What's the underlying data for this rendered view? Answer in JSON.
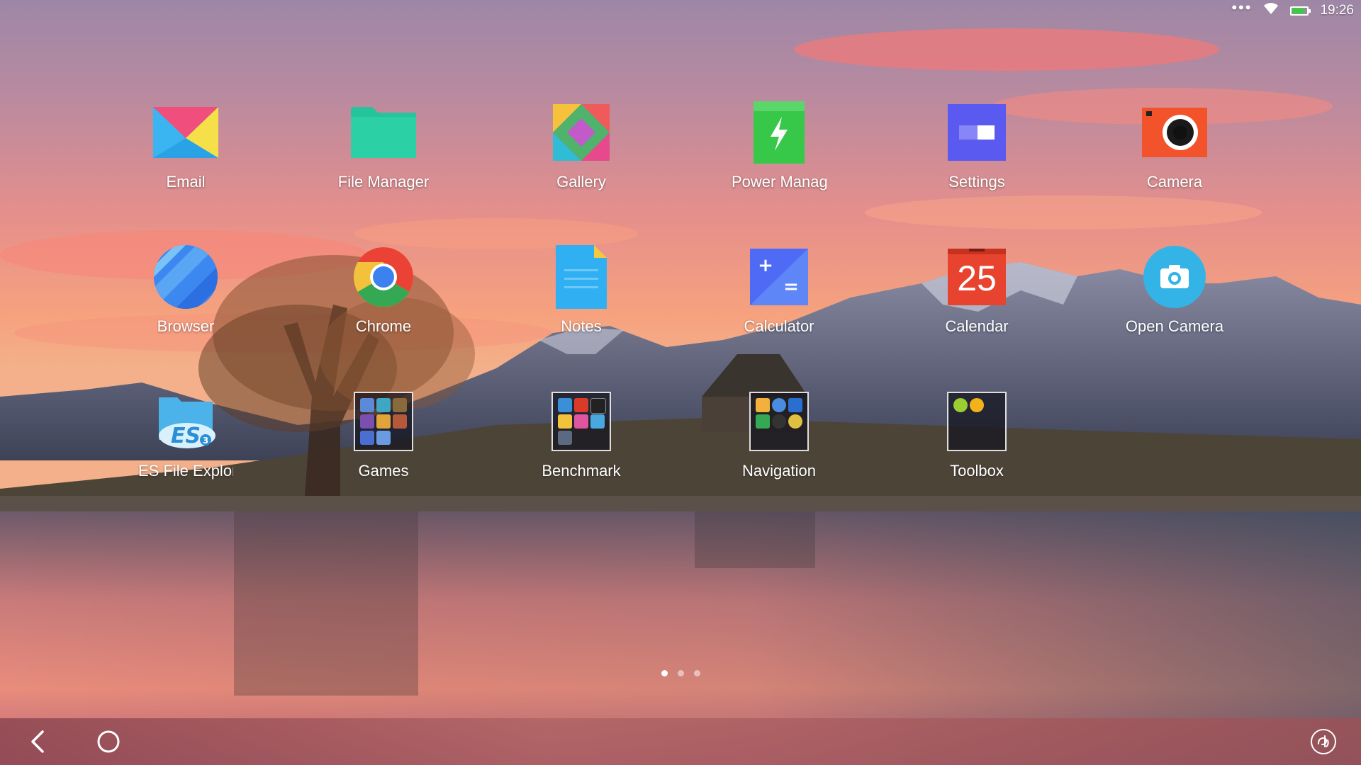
{
  "status_bar": {
    "time": "19:26",
    "icons": [
      "more-dots-icon",
      "wifi-icon",
      "battery-icon"
    ],
    "battery_level": 0.85,
    "battery_color": "#34d13c"
  },
  "apps": [
    {
      "label": "Email",
      "icon": "email-icon"
    },
    {
      "label": "File Manager",
      "icon": "folder-icon"
    },
    {
      "label": "Gallery",
      "icon": "gallery-icon"
    },
    {
      "label": "Power Manag",
      "icon": "power-icon"
    },
    {
      "label": "Settings",
      "icon": "settings-icon"
    },
    {
      "label": "Camera",
      "icon": "camera-icon"
    },
    {
      "label": "Browser",
      "icon": "browser-icon"
    },
    {
      "label": "Chrome",
      "icon": "chrome-icon"
    },
    {
      "label": "Notes",
      "icon": "notes-icon"
    },
    {
      "label": "Calculator",
      "icon": "calculator-icon"
    },
    {
      "label": "Calendar",
      "icon": "calendar-icon",
      "date": "25"
    },
    {
      "label": "Open Camera",
      "icon": "open-camera-icon"
    },
    {
      "label": "ES File Explor",
      "icon": "es-file-explorer-icon"
    },
    {
      "label": "Games",
      "icon": "folder-games-icon"
    },
    {
      "label": "Benchmark",
      "icon": "folder-benchmark-icon"
    },
    {
      "label": "Navigation",
      "icon": "folder-navigation-icon"
    },
    {
      "label": "Toolbox",
      "icon": "folder-toolbox-icon"
    }
  ],
  "pager": {
    "pages": 3,
    "current": 1
  },
  "nav_bar": {
    "buttons": [
      "back-icon",
      "home-icon",
      "assistant-icon"
    ]
  }
}
